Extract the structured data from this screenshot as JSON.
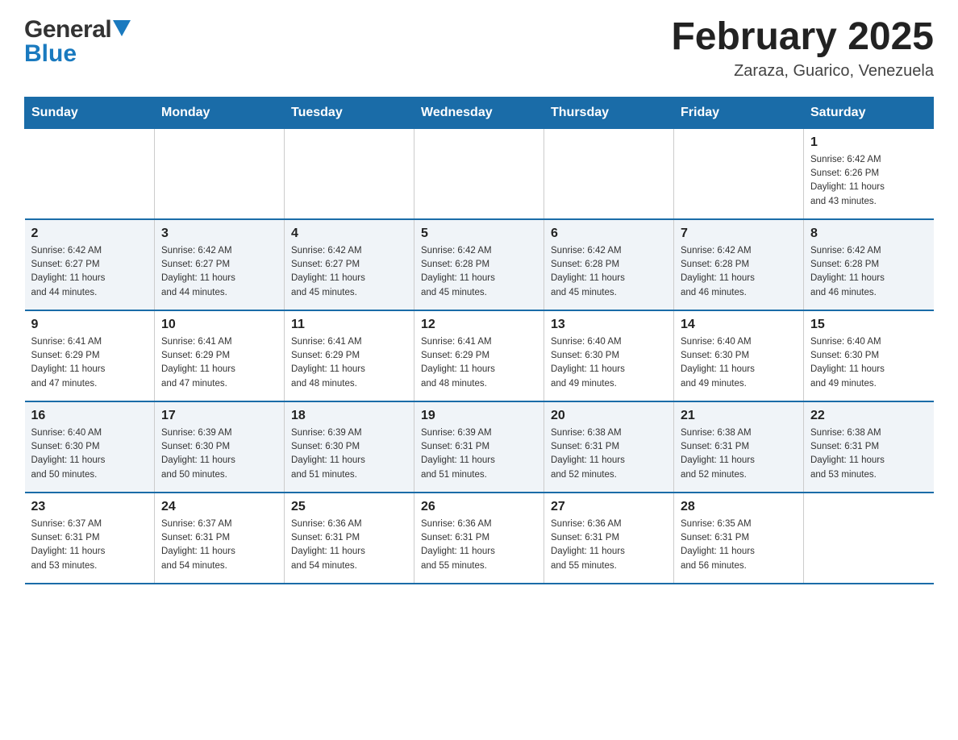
{
  "logo": {
    "general": "General",
    "blue": "Blue"
  },
  "header": {
    "month_year": "February 2025",
    "location": "Zaraza, Guarico, Venezuela"
  },
  "weekdays": [
    "Sunday",
    "Monday",
    "Tuesday",
    "Wednesday",
    "Thursday",
    "Friday",
    "Saturday"
  ],
  "rows": [
    [
      {
        "day": "",
        "info": ""
      },
      {
        "day": "",
        "info": ""
      },
      {
        "day": "",
        "info": ""
      },
      {
        "day": "",
        "info": ""
      },
      {
        "day": "",
        "info": ""
      },
      {
        "day": "",
        "info": ""
      },
      {
        "day": "1",
        "info": "Sunrise: 6:42 AM\nSunset: 6:26 PM\nDaylight: 11 hours\nand 43 minutes."
      }
    ],
    [
      {
        "day": "2",
        "info": "Sunrise: 6:42 AM\nSunset: 6:27 PM\nDaylight: 11 hours\nand 44 minutes."
      },
      {
        "day": "3",
        "info": "Sunrise: 6:42 AM\nSunset: 6:27 PM\nDaylight: 11 hours\nand 44 minutes."
      },
      {
        "day": "4",
        "info": "Sunrise: 6:42 AM\nSunset: 6:27 PM\nDaylight: 11 hours\nand 45 minutes."
      },
      {
        "day": "5",
        "info": "Sunrise: 6:42 AM\nSunset: 6:28 PM\nDaylight: 11 hours\nand 45 minutes."
      },
      {
        "day": "6",
        "info": "Sunrise: 6:42 AM\nSunset: 6:28 PM\nDaylight: 11 hours\nand 45 minutes."
      },
      {
        "day": "7",
        "info": "Sunrise: 6:42 AM\nSunset: 6:28 PM\nDaylight: 11 hours\nand 46 minutes."
      },
      {
        "day": "8",
        "info": "Sunrise: 6:42 AM\nSunset: 6:28 PM\nDaylight: 11 hours\nand 46 minutes."
      }
    ],
    [
      {
        "day": "9",
        "info": "Sunrise: 6:41 AM\nSunset: 6:29 PM\nDaylight: 11 hours\nand 47 minutes."
      },
      {
        "day": "10",
        "info": "Sunrise: 6:41 AM\nSunset: 6:29 PM\nDaylight: 11 hours\nand 47 minutes."
      },
      {
        "day": "11",
        "info": "Sunrise: 6:41 AM\nSunset: 6:29 PM\nDaylight: 11 hours\nand 48 minutes."
      },
      {
        "day": "12",
        "info": "Sunrise: 6:41 AM\nSunset: 6:29 PM\nDaylight: 11 hours\nand 48 minutes."
      },
      {
        "day": "13",
        "info": "Sunrise: 6:40 AM\nSunset: 6:30 PM\nDaylight: 11 hours\nand 49 minutes."
      },
      {
        "day": "14",
        "info": "Sunrise: 6:40 AM\nSunset: 6:30 PM\nDaylight: 11 hours\nand 49 minutes."
      },
      {
        "day": "15",
        "info": "Sunrise: 6:40 AM\nSunset: 6:30 PM\nDaylight: 11 hours\nand 49 minutes."
      }
    ],
    [
      {
        "day": "16",
        "info": "Sunrise: 6:40 AM\nSunset: 6:30 PM\nDaylight: 11 hours\nand 50 minutes."
      },
      {
        "day": "17",
        "info": "Sunrise: 6:39 AM\nSunset: 6:30 PM\nDaylight: 11 hours\nand 50 minutes."
      },
      {
        "day": "18",
        "info": "Sunrise: 6:39 AM\nSunset: 6:30 PM\nDaylight: 11 hours\nand 51 minutes."
      },
      {
        "day": "19",
        "info": "Sunrise: 6:39 AM\nSunset: 6:31 PM\nDaylight: 11 hours\nand 51 minutes."
      },
      {
        "day": "20",
        "info": "Sunrise: 6:38 AM\nSunset: 6:31 PM\nDaylight: 11 hours\nand 52 minutes."
      },
      {
        "day": "21",
        "info": "Sunrise: 6:38 AM\nSunset: 6:31 PM\nDaylight: 11 hours\nand 52 minutes."
      },
      {
        "day": "22",
        "info": "Sunrise: 6:38 AM\nSunset: 6:31 PM\nDaylight: 11 hours\nand 53 minutes."
      }
    ],
    [
      {
        "day": "23",
        "info": "Sunrise: 6:37 AM\nSunset: 6:31 PM\nDaylight: 11 hours\nand 53 minutes."
      },
      {
        "day": "24",
        "info": "Sunrise: 6:37 AM\nSunset: 6:31 PM\nDaylight: 11 hours\nand 54 minutes."
      },
      {
        "day": "25",
        "info": "Sunrise: 6:36 AM\nSunset: 6:31 PM\nDaylight: 11 hours\nand 54 minutes."
      },
      {
        "day": "26",
        "info": "Sunrise: 6:36 AM\nSunset: 6:31 PM\nDaylight: 11 hours\nand 55 minutes."
      },
      {
        "day": "27",
        "info": "Sunrise: 6:36 AM\nSunset: 6:31 PM\nDaylight: 11 hours\nand 55 minutes."
      },
      {
        "day": "28",
        "info": "Sunrise: 6:35 AM\nSunset: 6:31 PM\nDaylight: 11 hours\nand 56 minutes."
      },
      {
        "day": "",
        "info": ""
      }
    ]
  ]
}
